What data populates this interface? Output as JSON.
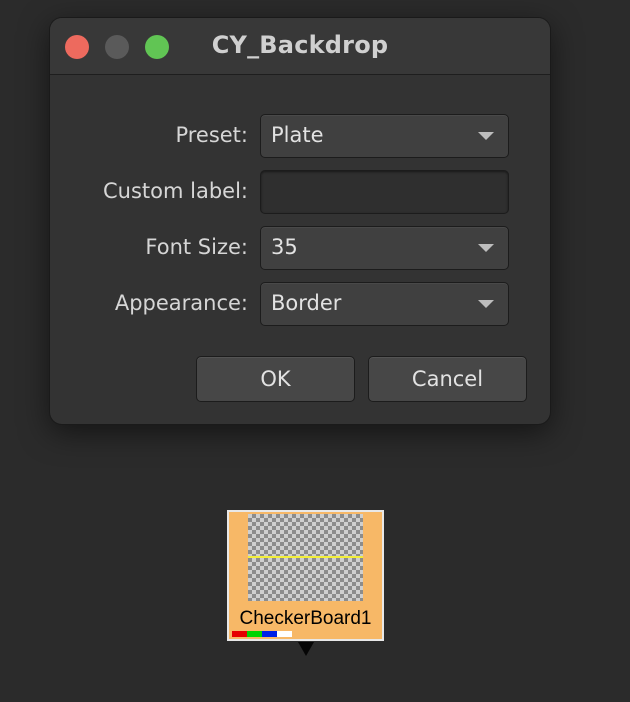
{
  "dialog": {
    "title": "CY_Backdrop",
    "window_controls": [
      "close",
      "minimize",
      "zoom"
    ],
    "fields": {
      "preset": {
        "label": "Preset:",
        "value": "Plate"
      },
      "custom_label": {
        "label": "Custom label:",
        "value": ""
      },
      "font_size": {
        "label": "Font Size:",
        "value": "35"
      },
      "appearance": {
        "label": "Appearance:",
        "value": "Border"
      }
    },
    "buttons": {
      "ok": "OK",
      "cancel": "Cancel"
    }
  },
  "node": {
    "name": "CheckerBoard1",
    "color": "#f7b867",
    "channels": [
      "red",
      "green",
      "blue",
      "alpha"
    ]
  }
}
